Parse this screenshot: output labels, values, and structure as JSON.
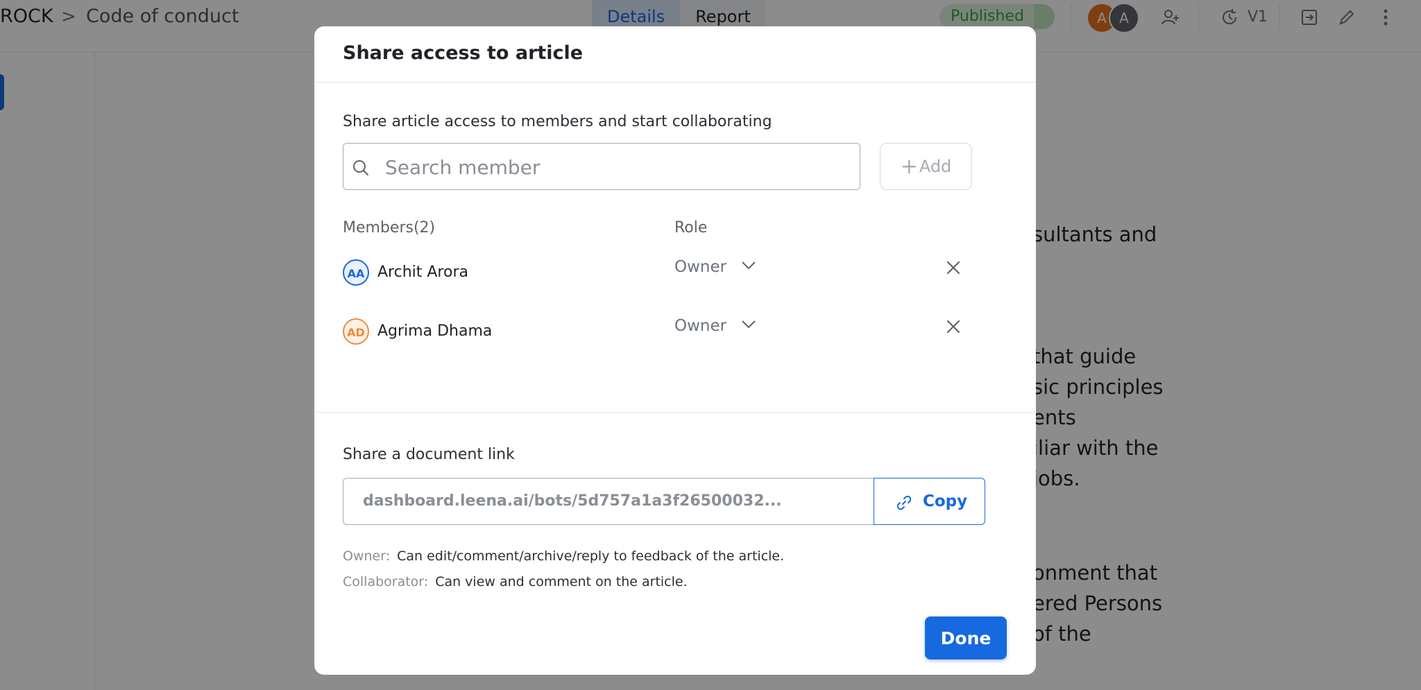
{
  "app": {
    "breadcrumb": {
      "root": "ROCK",
      "separator": ">",
      "page": "Code of conduct"
    },
    "tabs": [
      {
        "label": "Details",
        "active": true
      },
      {
        "label": "Report",
        "active": false
      }
    ],
    "status": "Published",
    "avatars": [
      "A",
      "A"
    ],
    "version": "V1",
    "article_fragments": [
      "sultants and",
      "that guide",
      "sic principles",
      "ents",
      "iliar with the",
      "jobs.",
      "onment that",
      "ered Persons",
      "of the"
    ]
  },
  "modal": {
    "title": "Share access to article",
    "intro": "Share article access to members and start collaborating",
    "search": {
      "placeholder": "Search member",
      "value": ""
    },
    "add_label": "Add",
    "members_header": "Members(2)",
    "role_header": "Role",
    "members": [
      {
        "initials": "AA",
        "name": "Archit Arora",
        "role": "Owner",
        "color": "#1769e0"
      },
      {
        "initials": "AD",
        "name": "Agrima Dhama",
        "role": "Owner",
        "color": "#f08a3c"
      }
    ],
    "link_title": "Share a document link",
    "link_value": "dashboard.leena.ai/bots/5d757a1a3f26500032...",
    "copy_label": "Copy",
    "notes": [
      {
        "key": "Owner:",
        "value": "Can edit/comment/archive/reply to feedback of the article."
      },
      {
        "key": "Collaborator:",
        "value": "Can view and comment on the article."
      }
    ],
    "done_label": "Done"
  },
  "colors": {
    "accent": "#1769e0",
    "published": "#3aa33a",
    "overlay": "rgba(0,0,0,0.45)"
  },
  "icons": [
    "search-icon",
    "plus-icon",
    "chevron-down-icon",
    "close-icon",
    "link-icon",
    "add-user-icon",
    "history-icon",
    "export-icon",
    "pencil-icon",
    "more-vertical-icon"
  ]
}
